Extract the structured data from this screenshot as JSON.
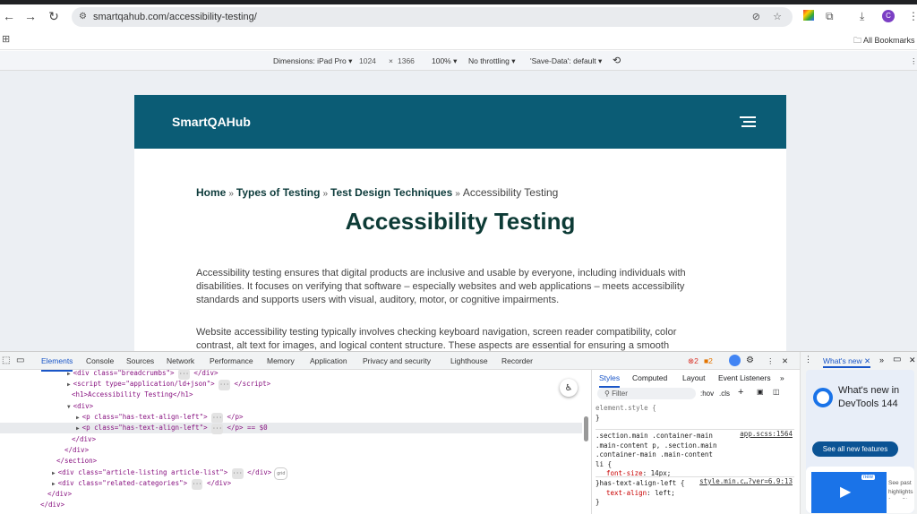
{
  "browser": {
    "url": "smartqahub.com/accessibility-testing/",
    "all_bookmarks": "All Bookmarks",
    "profile_initial": "C"
  },
  "device_toolbar": {
    "dimensions": "Dimensions: iPad Pro",
    "width": "1024",
    "times": "×",
    "height": "1366",
    "zoom": "100%",
    "throttling": "No throttling",
    "save_data": "'Save-Data': default"
  },
  "site": {
    "logo": "SmartQAHub",
    "breadcrumbs": [
      "Home",
      "Types of Testing",
      "Test Design Techniques",
      "Accessibility Testing"
    ],
    "separator": "»",
    "title": "Accessibility Testing",
    "paragraphs": [
      "Accessibility testing ensures that digital products are inclusive and usable by everyone, including individuals with disabilities. It focuses on verifying that software – especially websites and web applications – meets accessibility standards and supports users with visual, auditory, motor, or cognitive impairments.",
      "Website accessibility testing typically involves checking keyboard navigation, screen reader compatibility, color contrast, alt text for images, and logical content structure. These aspects are essential for ensuring a smooth"
    ]
  },
  "devtools": {
    "tabs": [
      "Elements",
      "Console",
      "Sources",
      "Network",
      "Performance",
      "Memory",
      "Application",
      "Privacy and security",
      "Lighthouse",
      "Recorder"
    ],
    "errors": "2",
    "warnings": "2",
    "dom": {
      "l1": "<div class=\"breadcrumbs\">",
      "l1e": "</div>",
      "l2": "<script type=\"application/ld+json\">",
      "l2e": "</script>",
      "l3": "<h1>Accessibility Testing</h1>",
      "l4": "<div>",
      "l5": "<p class=\"has-text-align-left\">",
      "l5e": "</p>",
      "l6": "<p class=\"has-text-align-left\">",
      "l6e": "</p> == $0",
      "l7": "</div>",
      "l8": "</div>",
      "l9": "</section>",
      "l10": "<div class=\"article-listing article-list\">",
      "l10e": "</div>",
      "l10badge": "grid",
      "l11": "<div class=\"related-categories\">",
      "l11e": "</div>",
      "l12": "</div>",
      "l13": "</div>",
      "dots": "···"
    },
    "styles": {
      "tabs": [
        "Styles",
        "Computed",
        "Layout",
        "Event Listeners"
      ],
      "filter_placeholder": "Filter",
      "hov": ":hov",
      "cls": ".cls",
      "r0_sel": "element.style {",
      "close": "}",
      "r1_sel": ".section.main .container-main .main-content p, .section.main .container-main .main-content li {",
      "r1_src": "app.scss:1564",
      "r1_prop": "font-size",
      "r1_val": "14px;",
      "r2_sel": ".has-text-align-left {",
      "r2_src": "style.min.c…?ver=6.9:13",
      "r2_prop": "text-align",
      "r2_val": "left;"
    },
    "whats_new": {
      "tab": "What's new",
      "title": "What's new in DevTools 144",
      "button": "See all new features",
      "badge": "new",
      "teaser": "See past highlights from Ch"
    }
  }
}
